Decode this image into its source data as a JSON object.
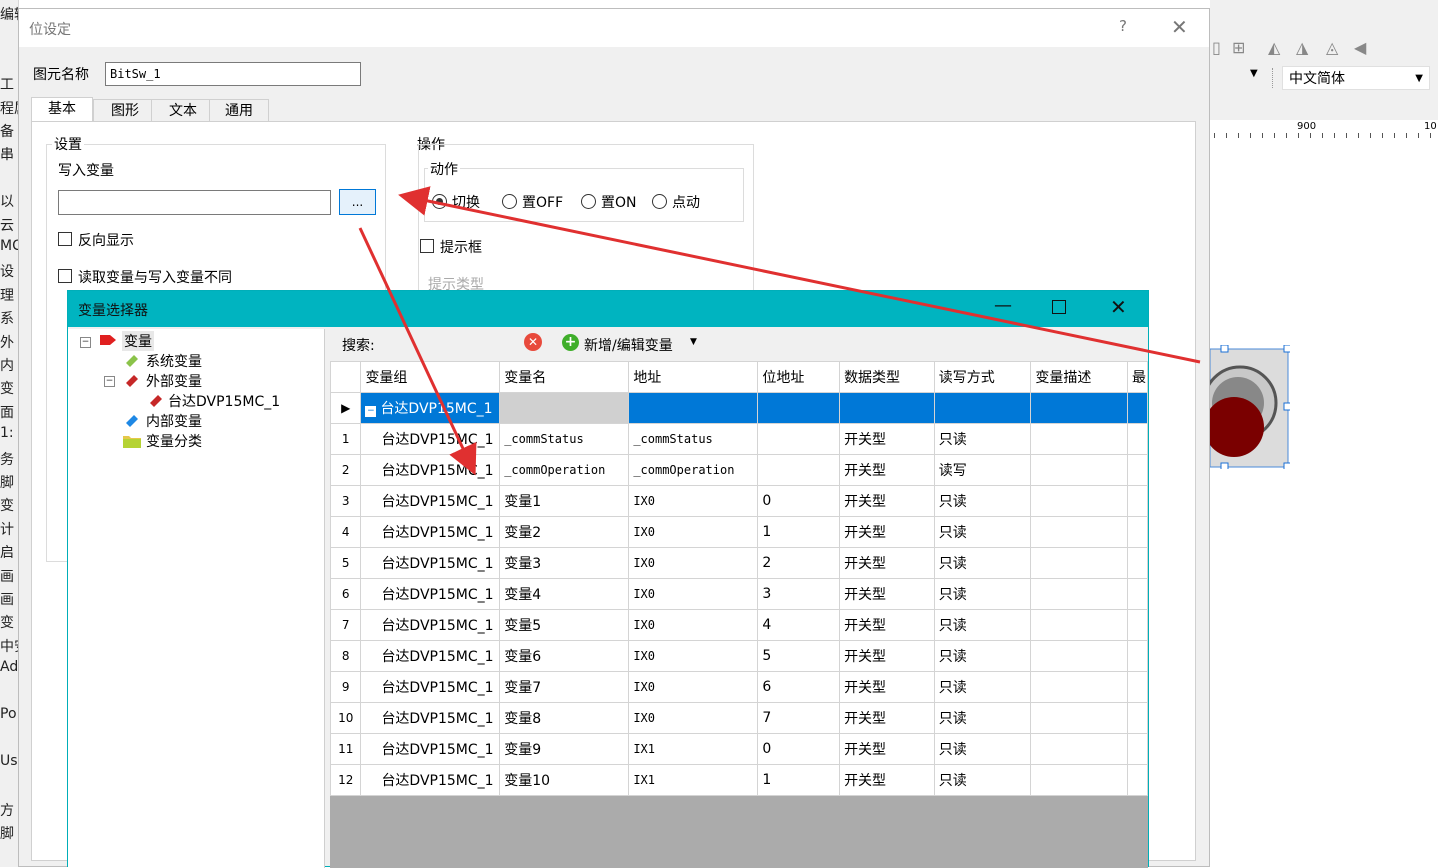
{
  "left_strip": [
    "编辑",
    "",
    "",
    "工",
    "程属",
    "备",
    "串",
    "",
    "以",
    "云",
    "MC",
    "设",
    "理",
    "系",
    "外",
    "内",
    "变",
    "面",
    "1:",
    "务",
    "脚",
    "变",
    "计",
    "启",
    "画",
    "画",
    "变",
    "中安",
    "Ad",
    "",
    "Po",
    "",
    "Us",
    "",
    "方",
    "脚"
  ],
  "background": {
    "language_select": "中文简体",
    "ruler_labels": [
      "900",
      "10"
    ]
  },
  "prop_dialog": {
    "title": "位设定",
    "help": "?",
    "close": "✕",
    "element_name_label": "图元名称",
    "element_name_value": "BitSw_1",
    "tabs": [
      {
        "label": "基本",
        "active": true
      },
      {
        "label": "图形",
        "active": false
      },
      {
        "label": "文本",
        "active": false
      },
      {
        "label": "通用",
        "active": false
      }
    ],
    "settings_title": "设置",
    "write_var_label": "写入变量",
    "write_var_value": "",
    "browse_label": "...",
    "reverse_display": "反向显示",
    "read_write_diff": "读取变量与写入变量不同",
    "operation_title": "操作",
    "action_title": "动作",
    "actions": [
      {
        "label": "切换",
        "checked": true
      },
      {
        "label": "置OFF",
        "checked": false
      },
      {
        "label": "置ON",
        "checked": false
      },
      {
        "label": "点动",
        "checked": false
      }
    ],
    "tip_box": "提示框",
    "tip_type": "提示类型"
  },
  "var_selector": {
    "title": "变量选择器",
    "tree": {
      "root": "变量",
      "system": "系统变量",
      "external": "外部变量",
      "device": "台达DVP15MC_1",
      "internal": "内部变量",
      "category": "变量分类"
    },
    "search_label": "搜索:",
    "search_value": "",
    "add_edit_label": "新增/编辑变量",
    "columns": [
      "变量组",
      "变量名",
      "地址",
      "位地址",
      "数据类型",
      "读写方式",
      "变量描述",
      "最"
    ],
    "group_row": {
      "group": "台达DVP15MC_1",
      "name": ""
    },
    "rows": [
      {
        "num": "1",
        "group": "台达DVP15MC_1",
        "name": "_commStatus",
        "addr": "_commStatus",
        "bit": "",
        "type": "开关型",
        "rw": "只读",
        "desc": ""
      },
      {
        "num": "2",
        "group": "台达DVP15MC_1",
        "name": "_commOperation",
        "addr": "_commOperation",
        "bit": "",
        "type": "开关型",
        "rw": "读写",
        "desc": ""
      },
      {
        "num": "3",
        "group": "台达DVP15MC_1",
        "name": "变量1",
        "addr": "IX0",
        "bit": "0",
        "type": "开关型",
        "rw": "只读",
        "desc": ""
      },
      {
        "num": "4",
        "group": "台达DVP15MC_1",
        "name": "变量2",
        "addr": "IX0",
        "bit": "1",
        "type": "开关型",
        "rw": "只读",
        "desc": ""
      },
      {
        "num": "5",
        "group": "台达DVP15MC_1",
        "name": "变量3",
        "addr": "IX0",
        "bit": "2",
        "type": "开关型",
        "rw": "只读",
        "desc": ""
      },
      {
        "num": "6",
        "group": "台达DVP15MC_1",
        "name": "变量4",
        "addr": "IX0",
        "bit": "3",
        "type": "开关型",
        "rw": "只读",
        "desc": ""
      },
      {
        "num": "7",
        "group": "台达DVP15MC_1",
        "name": "变量5",
        "addr": "IX0",
        "bit": "4",
        "type": "开关型",
        "rw": "只读",
        "desc": ""
      },
      {
        "num": "8",
        "group": "台达DVP15MC_1",
        "name": "变量6",
        "addr": "IX0",
        "bit": "5",
        "type": "开关型",
        "rw": "只读",
        "desc": ""
      },
      {
        "num": "9",
        "group": "台达DVP15MC_1",
        "name": "变量7",
        "addr": "IX0",
        "bit": "6",
        "type": "开关型",
        "rw": "只读",
        "desc": ""
      },
      {
        "num": "10",
        "group": "台达DVP15MC_1",
        "name": "变量8",
        "addr": "IX0",
        "bit": "7",
        "type": "开关型",
        "rw": "只读",
        "desc": ""
      },
      {
        "num": "11",
        "group": "台达DVP15MC_1",
        "name": "变量9",
        "addr": "IX1",
        "bit": "0",
        "type": "开关型",
        "rw": "只读",
        "desc": ""
      },
      {
        "num": "12",
        "group": "台达DVP15MC_1",
        "name": "变量10",
        "addr": "IX1",
        "bit": "1",
        "type": "开关型",
        "rw": "只读",
        "desc": ""
      }
    ]
  },
  "colors": {
    "selector_titlebar": "#00b4c0",
    "selection": "#0078d7",
    "annotation_arrow": "#e03030"
  }
}
